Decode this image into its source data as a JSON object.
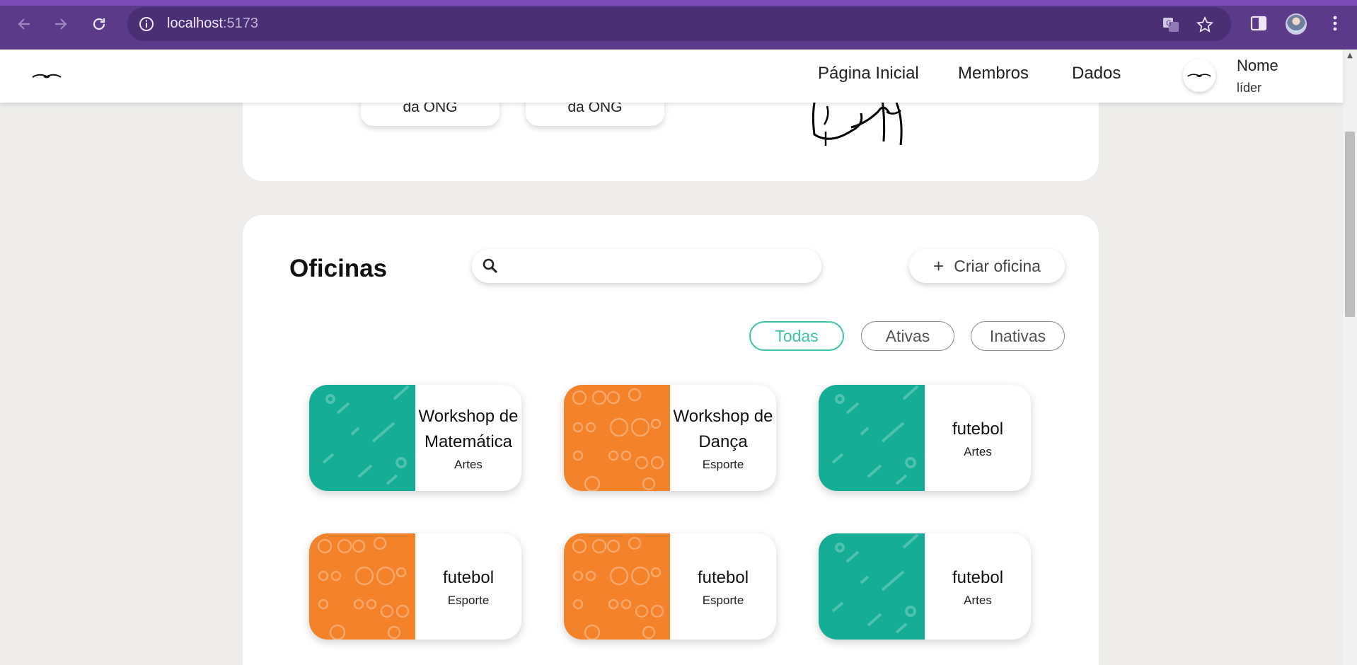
{
  "browser": {
    "url_host": "localhost",
    "url_port": ":5173"
  },
  "header": {
    "nav": [
      "Página Inicial",
      "Membros",
      "Dados"
    ],
    "user_name": "Nome",
    "user_role": "líder"
  },
  "top_section": {
    "cards": [
      "da ONG",
      "da ONG"
    ]
  },
  "oficinas": {
    "title": "Oficinas",
    "search_placeholder": "",
    "create_label": "Criar oficina",
    "filters": [
      "Todas",
      "Ativas",
      "Inativas"
    ],
    "active_filter": "Todas",
    "items": [
      {
        "name": "Workshop de Matemática",
        "category": "Artes",
        "theme": "teal"
      },
      {
        "name": "Workshop de Dança",
        "category": "Esporte",
        "theme": "orange"
      },
      {
        "name": "futebol",
        "category": "Artes",
        "theme": "teal"
      },
      {
        "name": "futebol",
        "category": "Esporte",
        "theme": "orange"
      },
      {
        "name": "futebol",
        "category": "Esporte",
        "theme": "orange"
      },
      {
        "name": "futebol",
        "category": "Artes",
        "theme": "teal"
      }
    ]
  },
  "colors": {
    "browser_bar": "#5b3a8a",
    "accent_teal": "#3cc3a8",
    "card_teal": "#15ad95",
    "card_orange": "#f4822a"
  }
}
